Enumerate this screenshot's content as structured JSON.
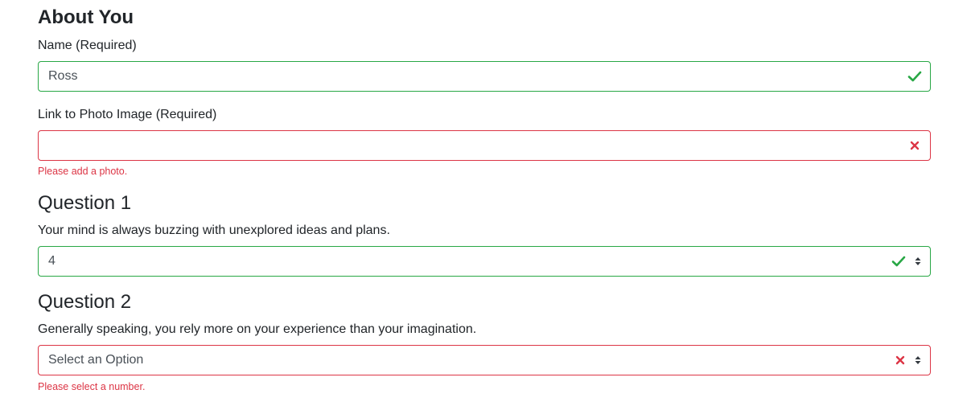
{
  "about": {
    "heading": "About You",
    "name_label": "Name (Required)",
    "name_value": "Ross",
    "photo_label": "Link to Photo Image (Required)",
    "photo_value": "",
    "photo_error": "Please add a photo."
  },
  "q1": {
    "heading": "Question 1",
    "prompt": "Your mind is always buzzing with unexplored ideas and plans.",
    "selected": "4"
  },
  "q2": {
    "heading": "Question 2",
    "prompt": "Generally speaking, you rely more on your experience than your imagination.",
    "selected": "Select an Option",
    "error": "Please select a number."
  },
  "colors": {
    "valid": "#28a745",
    "invalid": "#dc3545",
    "text": "#212529"
  },
  "icons": {
    "valid": "check-icon",
    "invalid": "x-icon",
    "select": "sort-caret-icon"
  }
}
